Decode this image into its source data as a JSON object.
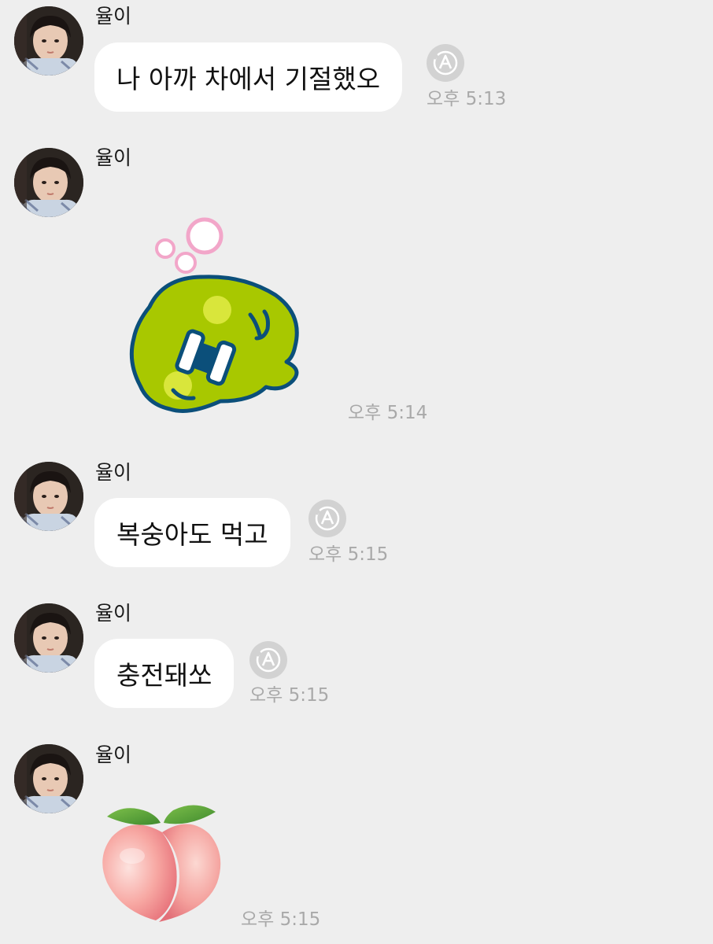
{
  "messages": [
    {
      "sender": "율이",
      "text": "나 아까 차에서 기절했오",
      "time": "오후 5:13",
      "type": "text"
    },
    {
      "sender": "율이",
      "sticker": "sleeping-green-blob-sticker",
      "time": "오후 5:14",
      "type": "sticker"
    },
    {
      "sender": "율이",
      "text": "복숭아도 먹고",
      "time": "오후 5:15",
      "type": "text"
    },
    {
      "sender": "율이",
      "text": "충전돼쏘",
      "time": "오후 5:15",
      "type": "text"
    },
    {
      "sender": "율이",
      "emoji": "peach-emoji",
      "time": "오후 5:15",
      "type": "emoji"
    }
  ],
  "colors": {
    "background": "#eeeeee",
    "bubble": "#ffffff",
    "timestamp": "#a9a9a9",
    "translate_icon_bg": "#d2d2d2",
    "sticker_green": "#a8c800",
    "sticker_outline": "#0b4f7a",
    "bubble_pink": "#f2a6c9"
  }
}
